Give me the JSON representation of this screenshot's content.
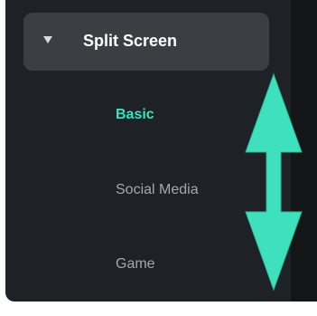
{
  "sidebar": {
    "category": {
      "label": "Split Screen",
      "expanded": true,
      "icon": "caret-down-icon"
    },
    "items": [
      {
        "label": "Basic",
        "selected": true
      },
      {
        "label": "Social Media",
        "selected": false
      },
      {
        "label": "Game",
        "selected": false
      }
    ]
  },
  "annotation": {
    "icon": "double-headed-vertical-arrow",
    "color": "#3fe0bd"
  },
  "colors": {
    "panel_background": "#1e2125",
    "category_background": "#3b3f44",
    "active_text": "#3fe0bd",
    "inactive_text": "#a5a8ac"
  }
}
